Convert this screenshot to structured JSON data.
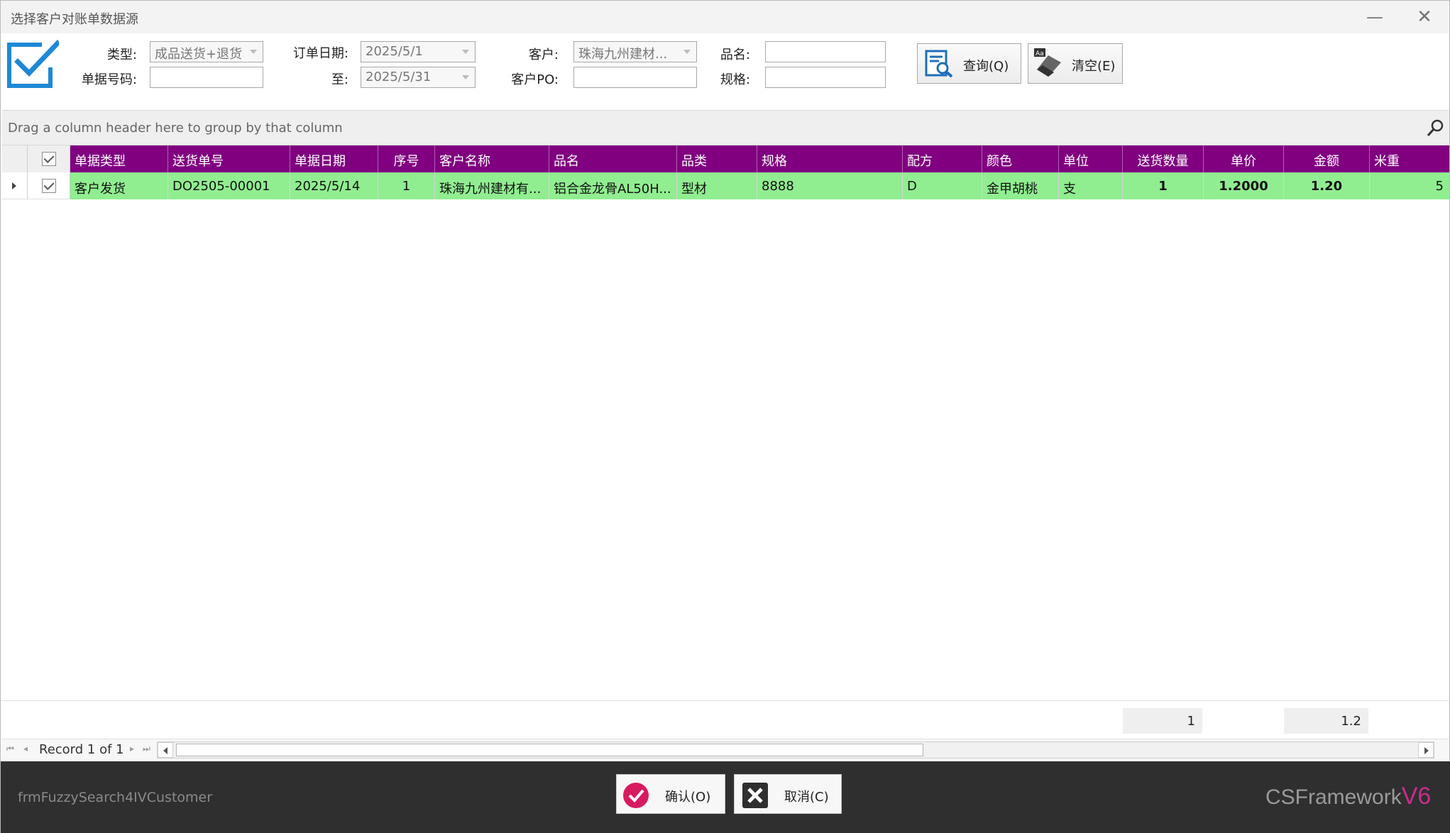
{
  "window": {
    "title": "选择客户对账单数据源",
    "minimize_glyph": "—",
    "close_glyph": "✕"
  },
  "filters": {
    "type_label": "类型:",
    "type_value": "成品送货+退货",
    "doc_no_label": "单据号码:",
    "doc_no_value": "",
    "order_date_label": "订单日期:",
    "order_date_from": "2025/5/1",
    "to_label": "至:",
    "order_date_to": "2025/5/31",
    "customer_label": "客户:",
    "customer_value": "珠海九州建材...",
    "customer_po_label": "客户PO:",
    "customer_po_value": "",
    "product_name_label": "品名:",
    "product_name_value": "",
    "spec_label": "规格:",
    "spec_value": "",
    "query_button": "查询(Q)",
    "clear_button": "清空(E)",
    "clear_icon_text": "Aa"
  },
  "group_panel": {
    "hint": "Drag a column header here to group by that column"
  },
  "grid": {
    "columns": [
      "单据类型",
      "送货单号",
      "单据日期",
      "序号",
      "客户名称",
      "品名",
      "品类",
      "规格",
      "配方",
      "颜色",
      "单位",
      "送货数量",
      "单价",
      "金额",
      "米重"
    ],
    "rows": [
      {
        "checked": true,
        "doc_type": "客户发货",
        "delivery_no": "DO2505-00001",
        "doc_date": "2025/5/14",
        "seq": "1",
        "customer_name": "珠海九州建材有...",
        "product_name": "铝合金龙骨AL50H...",
        "category": "型材",
        "spec": "8888",
        "formula": "D",
        "color": "金甲胡桃",
        "unit": "支",
        "qty": "1",
        "unit_price": "1.2000",
        "amount": "1.20",
        "meter_weight": "5"
      }
    ],
    "summary": {
      "qty_total": "1",
      "amount_total": "1.2"
    }
  },
  "navigator": {
    "record_text": "Record 1 of 1"
  },
  "bottom": {
    "form_name": "frmFuzzySearch4IVCustomer",
    "confirm_button": "确认(O)",
    "cancel_button": "取消(C)",
    "brand_prefix": "CSFramework",
    "brand_version": "V6"
  },
  "colors": {
    "header_bg": "#800080",
    "row_bg": "#90ee90",
    "bottom_bar": "#2f2f2f",
    "logo_blue": "#1e88d6",
    "brand_accent": "#c82d8c",
    "confirm_accent": "#d81b60"
  },
  "icons": {
    "logo": "checkbox-check-icon",
    "query": "document-search-icon",
    "clear": "eraser-icon",
    "search": "search-icon",
    "confirm": "check-circle-icon",
    "cancel": "close-square-icon"
  }
}
